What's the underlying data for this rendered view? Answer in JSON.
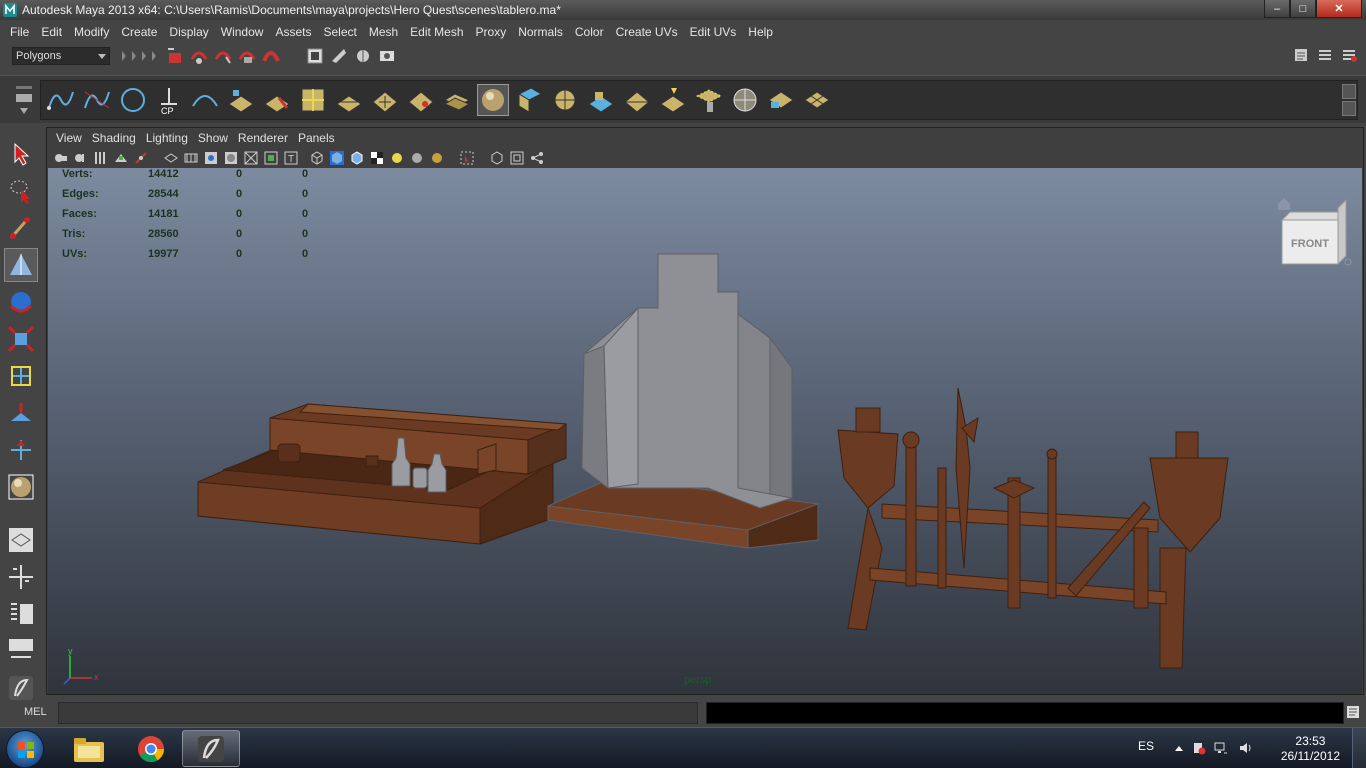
{
  "window": {
    "title": "Autodesk Maya 2013 x64: C:\\Users\\Ramis\\Documents\\maya\\projects\\Hero Quest\\scenes\\tablero.ma*",
    "controls": [
      "minimize-icon",
      "maximize-icon",
      "close-icon"
    ]
  },
  "menubar": {
    "items": [
      "File",
      "Edit",
      "Modify",
      "Create",
      "Display",
      "Window",
      "Assets",
      "Select",
      "Mesh",
      "Edit Mesh",
      "Proxy",
      "Normals",
      "Color",
      "Create UVs",
      "Edit UVs",
      "Help"
    ]
  },
  "statusline": {
    "mode": "Polygons"
  },
  "panel": {
    "menu": [
      "View",
      "Shading",
      "Lighting",
      "Show",
      "Renderer",
      "Panels"
    ]
  },
  "hud": {
    "rows": [
      {
        "label": "Verts:",
        "v1": "14412",
        "v2": "0",
        "v3": "0"
      },
      {
        "label": "Edges:",
        "v1": "28544",
        "v2": "0",
        "v3": "0"
      },
      {
        "label": "Faces:",
        "v1": "14181",
        "v2": "0",
        "v3": "0"
      },
      {
        "label": "Tris:",
        "v1": "28560",
        "v2": "0",
        "v3": "0"
      },
      {
        "label": "UVs:",
        "v1": "19977",
        "v2": "0",
        "v3": "0"
      }
    ]
  },
  "viewport": {
    "camera": "persp",
    "viewcube_face": "FRONT",
    "axis_x": "x",
    "axis_y": "y",
    "colors": {
      "wood": "#6b3a22",
      "stone": "#8e9095",
      "bg_top": "#7d8ba0",
      "bg_bottom": "#2f343c"
    }
  },
  "cmdline": {
    "label": "MEL"
  },
  "taskbar": {
    "language": "ES",
    "time": "23:53",
    "date": "26/11/2012",
    "apps": [
      "explorer-icon",
      "chrome-icon",
      "maya-icon"
    ]
  }
}
